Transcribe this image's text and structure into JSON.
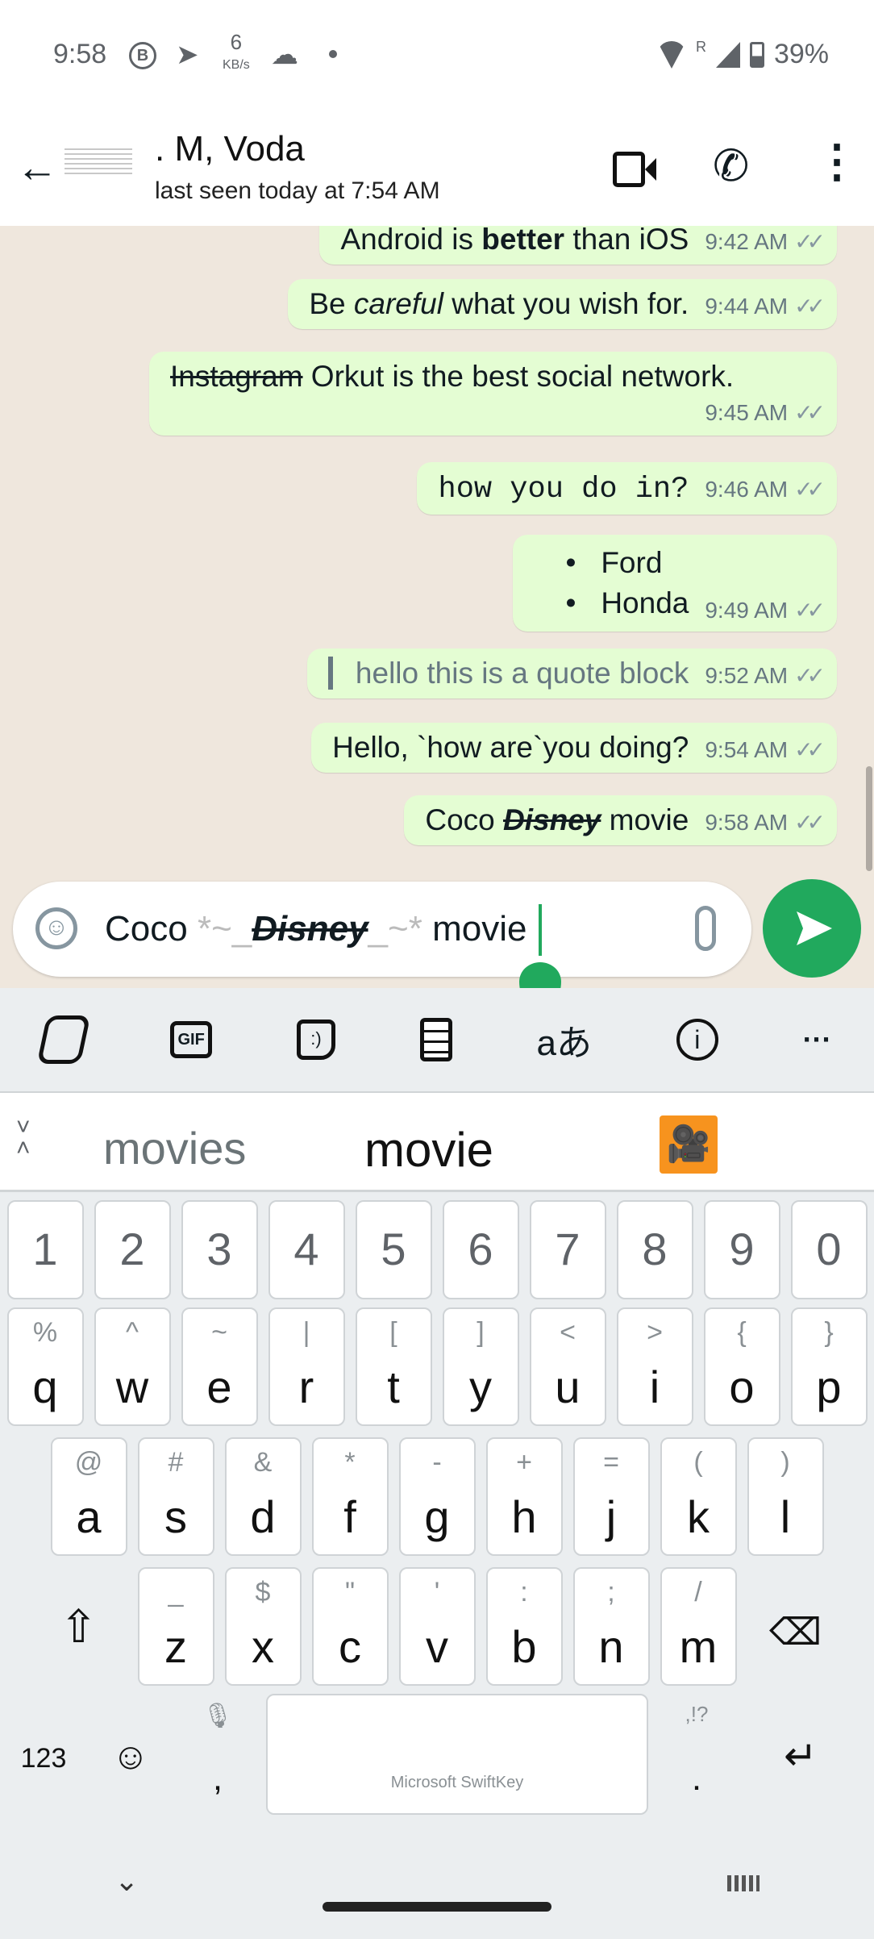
{
  "status": {
    "time": "9:58",
    "speed_value": "6",
    "speed_unit": "KB/s",
    "roaming": "R",
    "battery": "39%"
  },
  "header": {
    "name": ". M, Voda",
    "last_seen": "last seen today at 7:54 AM"
  },
  "messages": [
    {
      "pre": "Android is ",
      "bold": "better",
      "post": " than iOS",
      "time": "9:42 AM"
    },
    {
      "pre": "Be ",
      "italic": "careful",
      "post": " what you wish for.",
      "time": "9:44 AM"
    },
    {
      "strike": "Instagram",
      "post": " Orkut is the best social network.",
      "time": "9:45 AM"
    },
    {
      "mono": "how you do in?",
      "time": "9:46 AM"
    },
    {
      "bullets": [
        "Ford",
        "Honda"
      ],
      "time": "9:49 AM"
    },
    {
      "quote": "hello this is a quote block",
      "time": "9:52 AM"
    },
    {
      "text": "Hello, `how are`you doing?",
      "time": "9:54 AM"
    },
    {
      "pre": "Coco ",
      "bold_italic_strike": "Disney",
      "post": " movie",
      "time": "9:58 AM"
    }
  ],
  "input": {
    "pre": "Coco ",
    "m1": "*~_",
    "styled": "Disney",
    "m2": "_~*",
    "post": " movie"
  },
  "keyboard": {
    "suggestions": [
      "movies",
      "movie"
    ],
    "numbers": [
      "1",
      "2",
      "3",
      "4",
      "5",
      "6",
      "7",
      "8",
      "9",
      "0"
    ],
    "row1": [
      [
        "q",
        "%"
      ],
      [
        "w",
        "^"
      ],
      [
        "e",
        "~"
      ],
      [
        "r",
        "|"
      ],
      [
        "t",
        "["
      ],
      [
        "y",
        "]"
      ],
      [
        "u",
        "<"
      ],
      [
        "i",
        ">"
      ],
      [
        "o",
        "{"
      ],
      [
        "p",
        "}"
      ]
    ],
    "row2": [
      [
        "a",
        "@"
      ],
      [
        "s",
        "#"
      ],
      [
        "d",
        "&"
      ],
      [
        "f",
        "*"
      ],
      [
        "g",
        "-"
      ],
      [
        "h",
        "+"
      ],
      [
        "j",
        "="
      ],
      [
        "k",
        "("
      ],
      [
        "l",
        ")"
      ]
    ],
    "row3": [
      [
        "z",
        "_"
      ],
      [
        "x",
        "$"
      ],
      [
        "c",
        "\""
      ],
      [
        "v",
        "'"
      ],
      [
        "b",
        ":"
      ],
      [
        "n",
        ";"
      ],
      [
        "m",
        "/"
      ]
    ],
    "key_123": "123",
    "comma": ",",
    "period": ".",
    "period_alt": ",!?",
    "space_label": "Microsoft SwiftKey",
    "gif": "GIF"
  },
  "colors": {
    "accent": "#21a95d",
    "bubble": "#e4fdd3",
    "chat_bg": "#efe7dd",
    "sticker": "#f7931e"
  }
}
